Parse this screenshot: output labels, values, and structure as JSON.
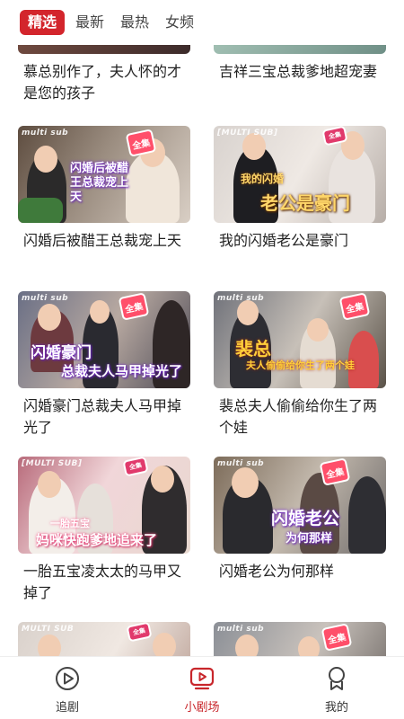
{
  "tabs": [
    "精选",
    "最新",
    "最热",
    "女频"
  ],
  "partial_card_titles": [
    "慕总别作了，夫人怀的才是您的孩子",
    "吉祥三宝总裁爹地超宠妻"
  ],
  "cards": [
    {
      "title": "闪婚后被醋王总裁宠上天",
      "tag": "multi sub",
      "art": "闪婚后被醋王总裁宠上天"
    },
    {
      "title": "我的闪婚老公是豪门",
      "tag": "[MULTI SUB]",
      "art": "老公是豪门",
      "art2": "我的闪婚"
    },
    {
      "title": "闪婚豪门总裁夫人马甲掉光了",
      "tag": "multi sub",
      "art": "闪婚豪门",
      "art2": "总裁夫人马甲掉光了"
    },
    {
      "title": "裴总夫人偷偷给你生了两个娃",
      "tag": "multi sub",
      "art": "裴总",
      "art2": "夫人偷偷给你生了两个娃"
    },
    {
      "title": "一胎五宝凌太太的马甲又掉了",
      "tag": "[MULTI SUB]",
      "art": "一胎五宝",
      "art2": "妈咪快跑爹地追来了"
    },
    {
      "title": "闪婚老公为何那样",
      "tag": "multi sub",
      "art": "闪婚老公",
      "art2": "为何那样"
    },
    {
      "title": "",
      "tag": "MULTI SUB"
    },
    {
      "title": "",
      "tag": "multi sub"
    }
  ],
  "badge_text": "全集",
  "nav": [
    {
      "label": "追剧",
      "icon": "play-circle-icon",
      "active": false
    },
    {
      "label": "小剧场",
      "icon": "tv-play-icon",
      "active": true
    },
    {
      "label": "我的",
      "icon": "user-icon",
      "active": false
    }
  ],
  "colors": {
    "accent": "#d3252c",
    "nav_active": "#c8262b"
  }
}
